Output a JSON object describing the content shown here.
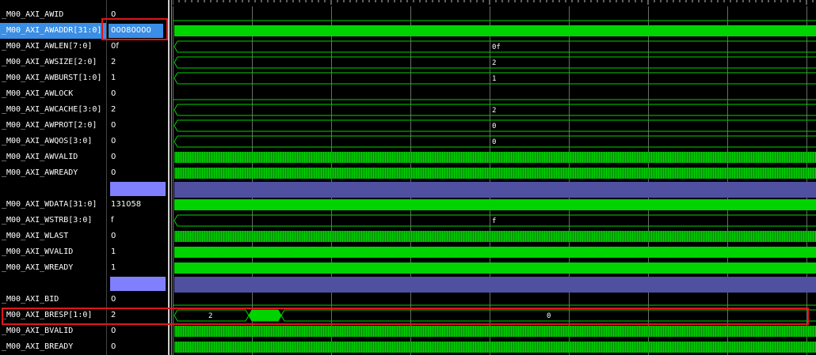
{
  "signals": [
    {
      "name": "_M00_AXI_AWID",
      "value": "0",
      "wave": "const",
      "mid": ""
    },
    {
      "name": "_M00_AXI_AWADDR[31:0]",
      "value": "00080000",
      "wave": "solid",
      "selected": true
    },
    {
      "name": "_M00_AXI_AWLEN[7:0]",
      "value": "0f",
      "wave": "bus",
      "mid": "0f"
    },
    {
      "name": "_M00_AXI_AWSIZE[2:0]",
      "value": "2",
      "wave": "bus",
      "mid": "2"
    },
    {
      "name": "_M00_AXI_AWBURST[1:0]",
      "value": "1",
      "wave": "bus",
      "mid": "1"
    },
    {
      "name": "_M00_AXI_AWLOCK",
      "value": "0",
      "wave": "const",
      "mid": ""
    },
    {
      "name": "_M00_AXI_AWCACHE[3:0]",
      "value": "2",
      "wave": "bus",
      "mid": "2"
    },
    {
      "name": "_M00_AXI_AWPROT[2:0]",
      "value": "0",
      "wave": "bus",
      "mid": "0"
    },
    {
      "name": "_M00_AXI_AWQOS[3:0]",
      "value": "0",
      "wave": "bus",
      "mid": "0"
    },
    {
      "name": "_M00_AXI_AWVALID",
      "value": "0",
      "wave": "dense"
    },
    {
      "name": "_M00_AXI_AWREADY",
      "value": "0",
      "wave": "dense"
    },
    {
      "name": "",
      "value": "",
      "wave": "divider"
    },
    {
      "name": "_M00_AXI_WDATA[31:0]",
      "value": "131058",
      "wave": "solid"
    },
    {
      "name": "_M00_AXI_WSTRB[3:0]",
      "value": "f",
      "wave": "bus",
      "mid": "f"
    },
    {
      "name": "_M00_AXI_WLAST",
      "value": "0",
      "wave": "dense"
    },
    {
      "name": "_M00_AXI_WVALID",
      "value": "1",
      "wave": "solid"
    },
    {
      "name": "_M00_AXI_WREADY",
      "value": "1",
      "wave": "solid"
    },
    {
      "name": "",
      "value": "",
      "wave": "divider"
    },
    {
      "name": "_M00_AXI_BID",
      "value": "0",
      "wave": "const",
      "mid": ""
    },
    {
      "name": "_M00_AXI_BRESP[1:0]",
      "value": "2",
      "wave": "bresp",
      "seg1": "2",
      "seg3": "0"
    },
    {
      "name": "_M00_AXI_BVALID",
      "value": "0",
      "wave": "dense"
    },
    {
      "name": "_M00_AXI_BREADY",
      "value": "0",
      "wave": "dense"
    }
  ],
  "colors": {
    "wave": "#00d400",
    "divider": "#5050a0",
    "grid": "#6a6a6a",
    "highlight": "#e0151b"
  }
}
